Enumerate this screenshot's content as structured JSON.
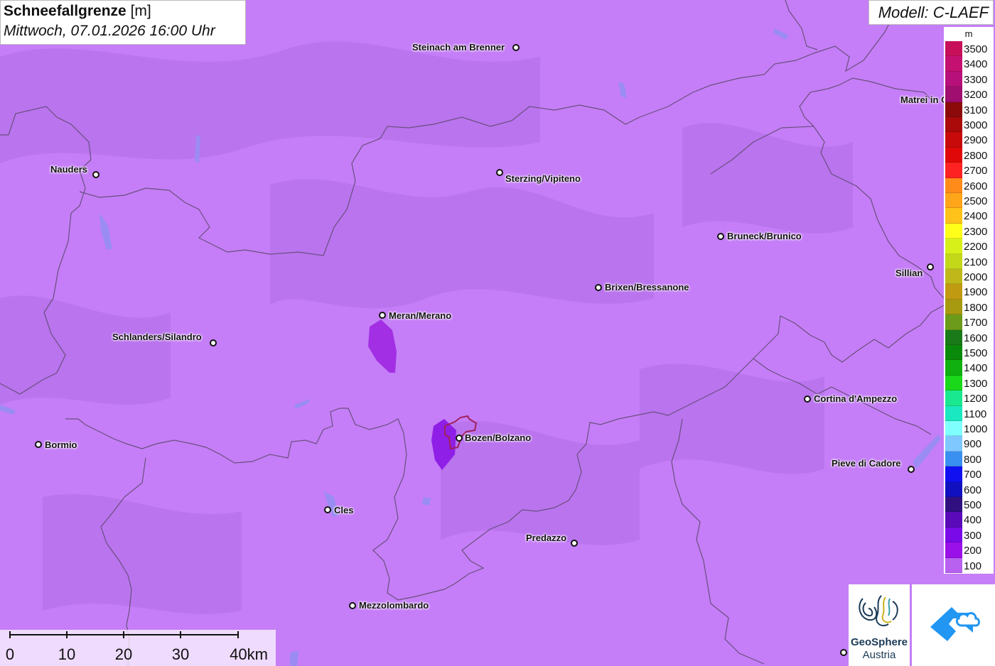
{
  "header": {
    "title": "Schneefallgrenze",
    "unit": "[m]",
    "datetime": "Mittwoch, 07.01.2026 16:00 Uhr"
  },
  "model": {
    "label": "Modell: C-LAEF"
  },
  "legend": {
    "unit": "m",
    "entries": [
      {
        "value": "3500",
        "color": "#c8105a"
      },
      {
        "value": "3400",
        "color": "#c41070"
      },
      {
        "value": "3300",
        "color": "#b8107a"
      },
      {
        "value": "3200",
        "color": "#a00e70"
      },
      {
        "value": "3100",
        "color": "#8c0a0a"
      },
      {
        "value": "3000",
        "color": "#aa0a0a"
      },
      {
        "value": "2900",
        "color": "#c80a0a"
      },
      {
        "value": "2800",
        "color": "#e00808"
      },
      {
        "value": "2700",
        "color": "#ff2222"
      },
      {
        "value": "2600",
        "color": "#ff8c1a"
      },
      {
        "value": "2500",
        "color": "#ffa51a"
      },
      {
        "value": "2400",
        "color": "#ffc21a"
      },
      {
        "value": "2300",
        "color": "#ffff1a"
      },
      {
        "value": "2200",
        "color": "#d8f01a"
      },
      {
        "value": "2100",
        "color": "#c4d81a"
      },
      {
        "value": "2000",
        "color": "#c0b81a"
      },
      {
        "value": "1900",
        "color": "#c09a10"
      },
      {
        "value": "1800",
        "color": "#a89a10"
      },
      {
        "value": "1700",
        "color": "#6c9a1a"
      },
      {
        "value": "1600",
        "color": "#1a7a1a"
      },
      {
        "value": "1500",
        "color": "#0a8a0a"
      },
      {
        "value": "1400",
        "color": "#10b010"
      },
      {
        "value": "1300",
        "color": "#1ad81a"
      },
      {
        "value": "1200",
        "color": "#1ae890"
      },
      {
        "value": "1100",
        "color": "#1ae8c0"
      },
      {
        "value": "1000",
        "color": "#80ffff"
      },
      {
        "value": "900",
        "color": "#7ec8ff"
      },
      {
        "value": "800",
        "color": "#3a90f0"
      },
      {
        "value": "700",
        "color": "#1010f0"
      },
      {
        "value": "600",
        "color": "#1010c0"
      },
      {
        "value": "500",
        "color": "#301080"
      },
      {
        "value": "400",
        "color": "#5a0ab8"
      },
      {
        "value": "300",
        "color": "#7a0ae8"
      },
      {
        "value": "200",
        "color": "#9a10e8"
      },
      {
        "value": "100",
        "color": "#b860f0"
      }
    ]
  },
  "scalebar": {
    "labels": [
      "0",
      "10",
      "20",
      "30",
      "40km"
    ]
  },
  "cities": [
    {
      "name": "Steinach am Brenner"
    },
    {
      "name": "Nauders"
    },
    {
      "name": "Sterzing/Vipiteno"
    },
    {
      "name": "Matrei in Osttirol"
    },
    {
      "name": "Bruneck/Brunico"
    },
    {
      "name": "Sillian"
    },
    {
      "name": "Brixen/Bressanone"
    },
    {
      "name": "Meran/Merano"
    },
    {
      "name": "Schlanders/Silandro"
    },
    {
      "name": "Cortina d'Ampezzo"
    },
    {
      "name": "Bormio"
    },
    {
      "name": "Bozen/Bolzano"
    },
    {
      "name": "Pieve di Cadore"
    },
    {
      "name": "Cles"
    },
    {
      "name": "Predazzo"
    },
    {
      "name": "Mezzolombardo"
    }
  ],
  "logos": {
    "geosphere_line1": "GeoSphere",
    "geosphere_line2": "Austria"
  },
  "colors": {
    "map_background": "#c57ef7",
    "border": "#6a4f7e",
    "lake": "#9a8cf2",
    "bolzano_outline": "#a0205a"
  }
}
